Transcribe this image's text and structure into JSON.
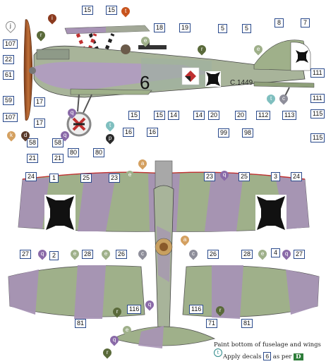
{
  "colors": {
    "callout_border": "#2a4a8c",
    "lozenge_green": "#9fb08a",
    "lozenge_lilac": "#a793b5",
    "fuselage_green": "#a8b49a",
    "propeller_wood": "#a85a2a",
    "tag_brown": "#8b3a1e",
    "tag_orange": "#c8541e",
    "tag_olive": "#5a6a3a",
    "tag_lilac": "#8a6aa8",
    "tag_tan": "#d4a060",
    "tag_teal": "#7fbfbf",
    "tag_dark": "#2a2a2a",
    "paint_green": "#2e7d3a"
  },
  "aircraft": {
    "code": "C.1449",
    "number": "6"
  },
  "side_view": {
    "callouts": [
      "15",
      "15",
      "18",
      "19",
      "5",
      "5",
      "8",
      "7",
      "107",
      "22",
      "61",
      "59",
      "107",
      "17",
      "17",
      "58",
      "58",
      "21",
      "21",
      "80",
      "80",
      "15",
      "15",
      "16",
      "16",
      "14",
      "14",
      "20",
      "20",
      "99",
      "98",
      "112",
      "113",
      "111",
      "111",
      "115",
      "115"
    ],
    "tags": [
      "j",
      "i",
      "t",
      "r",
      "e",
      "r",
      "d",
      "k",
      "q",
      "q",
      "t",
      "p",
      "e",
      "c",
      "t"
    ]
  },
  "plan_view": {
    "callouts": [
      "24",
      "25",
      "23",
      "23",
      "25",
      "3",
      "24",
      "1",
      "2",
      "4",
      "27",
      "28",
      "26",
      "26",
      "28",
      "27",
      "116",
      "116",
      "81",
      "71",
      "81"
    ],
    "tags": [
      "e",
      "a",
      "q",
      "a",
      "e",
      "q",
      "e",
      "c",
      "c",
      "e",
      "q",
      "q",
      "r",
      "r",
      "e",
      "q",
      "r"
    ]
  },
  "note": {
    "line1": "Paint bottom of fuselage and wings",
    "line1_ref": "t",
    "line2_pre": "Apply decals",
    "line2_decal": "6",
    "line2_mid": "as per",
    "line2_flag": "D"
  }
}
